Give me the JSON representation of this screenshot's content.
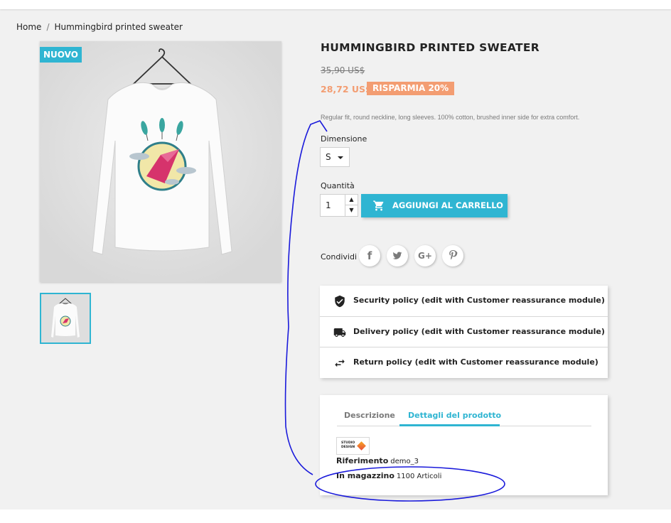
{
  "breadcrumb": {
    "items": [
      "Home",
      "Hummingbird printed sweater"
    ],
    "separator": "/"
  },
  "product": {
    "badge": "NUOVO",
    "title": "HUMMINGBIRD PRINTED SWEATER",
    "old_price": "35,90 US$",
    "price": "28,72 US$",
    "discount": "RISPARMIA 20%",
    "short_description": "Regular fit, round neckline, long sleeves. 100% cotton, brushed inner side for extra comfort.",
    "size_label": "Dimensione",
    "size_value": "S",
    "quantity_label": "Quantità",
    "quantity_value": "1",
    "add_to_cart": "AGGIUNGI AL CARRELLO",
    "share_label": "Condividi",
    "social": [
      {
        "name": "facebook",
        "glyph": "f"
      },
      {
        "name": "twitter",
        "glyph": "t"
      },
      {
        "name": "google-plus",
        "glyph": "G+"
      },
      {
        "name": "pinterest",
        "glyph": "P"
      }
    ]
  },
  "reassurance": [
    {
      "icon": "shield-icon",
      "text": "Security policy (edit with Customer reassurance module)"
    },
    {
      "icon": "truck-icon",
      "text": "Delivery policy (edit with Customer reassurance module)"
    },
    {
      "icon": "swap-arrows-icon",
      "text": "Return policy (edit with Customer reassurance module)"
    }
  ],
  "tabs": {
    "items": [
      "Descrizione",
      "Dettagli del prodotto"
    ],
    "active": "Dettagli del prodotto",
    "brand_logo_text": "STUDIO DESIGN",
    "reference_label": "Riferimento",
    "reference_value": "demo_3",
    "stock_label": "In magazzino",
    "stock_value": "1100 Articoli"
  },
  "colors": {
    "accent": "#2fb5d2",
    "discount": "#f39d72",
    "annotation": "#1a1adb"
  }
}
